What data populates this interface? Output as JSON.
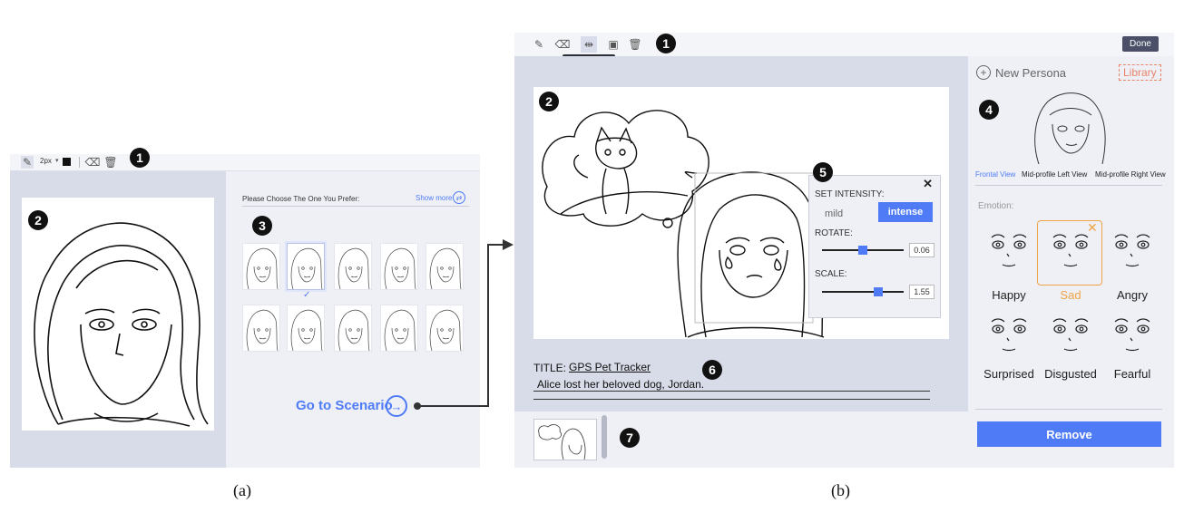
{
  "captions": {
    "a": "(a)",
    "b": "(b)"
  },
  "badges": {
    "a1": "1",
    "a2": "2",
    "a3": "3",
    "b1": "1",
    "b2": "2",
    "b4": "4",
    "b5": "5",
    "b6": "6",
    "b7": "7"
  },
  "panel_a": {
    "toolbar": {
      "stroke_size": "2px",
      "stroke_color": "#111111",
      "icons": [
        "pencil-icon",
        "size-dropdown",
        "color-swatch",
        "eraser-icon",
        "trash-icon"
      ]
    },
    "prompt": "Please Choose The One You Prefer:",
    "show_more": "Show more",
    "thumbnail_rows": 2,
    "thumbnails_per_row": 5,
    "selected_index": 1,
    "selected_mark": "✓",
    "go_button": "Go to Scenario"
  },
  "panel_b": {
    "toolbar": {
      "icons": [
        "pen-icon",
        "eraser-icon",
        "move-icon",
        "comment-icon",
        "trash-icon"
      ],
      "tooltip": "move",
      "done": "Done"
    },
    "intensity_popup": {
      "set_intensity": "SET INTENSITY:",
      "mild": "mild",
      "intense": "intense",
      "rotate_label": "ROTATE:",
      "rotate_value": "0.06",
      "scale_label": "SCALE:",
      "scale_value": "1.55",
      "close": "✕"
    },
    "story": {
      "title_label": "TITLE:",
      "title": "GPS Pet Tracker",
      "text": "Alice lost her beloved dog, Jordan."
    },
    "sidebar": {
      "new_persona": "New Persona",
      "library": "Library",
      "views": [
        "Frontal View",
        "Mid-profile Left View",
        "Mid-profile Right View"
      ],
      "active_view": "Frontal View",
      "emotion_label": "Emotion:",
      "emotions": [
        "Happy",
        "Sad",
        "Angry",
        "Surprised",
        "Disgusted",
        "Fearful"
      ],
      "selected_emotion": "Sad",
      "remove": "Remove"
    }
  },
  "colors": {
    "accent": "#4f7bf7",
    "selected_emotion": "#f0a347",
    "library_border": "#e8826a",
    "done_bg": "#4b5068",
    "badge": "#111111"
  }
}
